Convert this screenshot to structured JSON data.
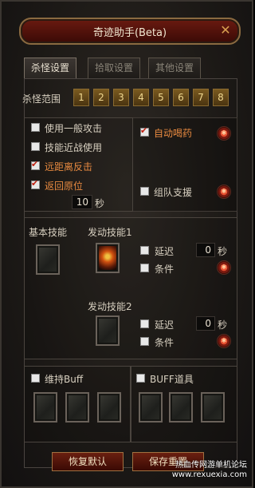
{
  "window": {
    "title": "奇迹助手(Beta)",
    "close_icon": "✕"
  },
  "tabs": [
    {
      "label": "杀怪设置",
      "active": true
    },
    {
      "label": "拾取设置",
      "active": false
    },
    {
      "label": "其他设置",
      "active": false
    }
  ],
  "range": {
    "label": "杀怪范围",
    "options": [
      "1",
      "2",
      "3",
      "4",
      "5",
      "6",
      "7",
      "8"
    ]
  },
  "combat": {
    "normal_attack": {
      "label": "使用一般攻击",
      "checked": false
    },
    "melee_skill": {
      "label": "技能近战使用",
      "checked": false
    },
    "ranged_counter": {
      "label": "远距离反击",
      "checked": true
    },
    "return_origin": {
      "label": "返回原位",
      "checked": true
    },
    "return_seconds": "10",
    "seconds_unit": "秒",
    "auto_potion": {
      "label": "自动喝药",
      "checked": true
    },
    "party_support": {
      "label": "组队支援",
      "checked": false
    }
  },
  "skills": {
    "basic_label": "基本技能",
    "skill1": {
      "label": "发动技能1",
      "delay_label": "延迟",
      "delay_value": "0",
      "unit": "秒",
      "condition_label": "条件"
    },
    "skill2": {
      "label": "发动技能2",
      "delay_label": "延迟",
      "delay_value": "0",
      "unit": "秒",
      "condition_label": "条件"
    }
  },
  "buffs": {
    "maintain_label": "维持Buff",
    "item_label": "BUFF道具"
  },
  "buttons": {
    "restore": "恢复默认",
    "save": "保存重置"
  },
  "watermark": {
    "line1": "热血传网游单机论坛",
    "line2": "www.rexuexia.com"
  },
  "colors": {
    "accent": "#e88a40",
    "title_bg": "#6a1a10"
  }
}
